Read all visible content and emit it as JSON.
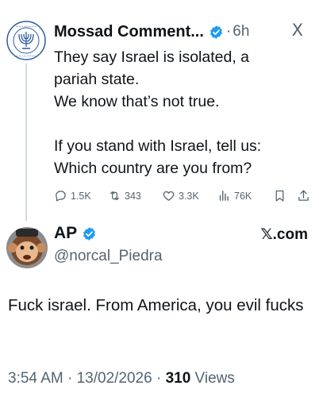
{
  "parent": {
    "display_name": "Mossad Comment...",
    "separator": "·",
    "time": "6h",
    "close_glyph": "X",
    "text_lines": [
      "They say Israel is isolated, a",
      "pariah state.",
      "We know that’s not true.",
      "",
      "If you stand with Israel, tell us:",
      "Which country are you from?"
    ],
    "actions": {
      "replies": "1.5K",
      "reposts": "343",
      "likes": "3.3K",
      "views": "76K"
    }
  },
  "reply": {
    "display_name": "AP",
    "handle": "@norcal_Piedra",
    "brand": "𝕏.com",
    "text": "Fuck israel. From America, you evil fucks",
    "time": "3:54 AM · 13/02/2026 · ",
    "views_count": "310",
    "views_label": " Views"
  },
  "colors": {
    "verified": "#1d9bf0",
    "secondary_text": "#536471",
    "primary_text": "#0f1419"
  },
  "icons": [
    "mossad-seal-icon",
    "verified-badge-icon",
    "close-x-icon",
    "reply-icon",
    "repost-icon",
    "like-icon",
    "views-icon",
    "bookmark-icon",
    "share-icon",
    "monkey-avatar-icon"
  ]
}
